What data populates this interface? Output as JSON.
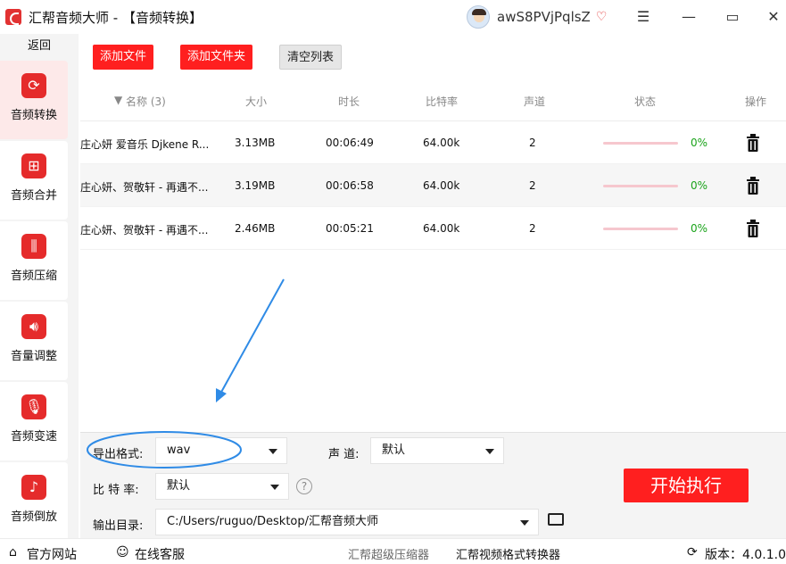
{
  "app": {
    "title": "汇帮音频大师 - 【音频转换】",
    "user": "awS8PVjPqlsZ"
  },
  "sidebar": {
    "back": "返回",
    "items": [
      {
        "label": "音频转换",
        "icon": "audio-convert-icon"
      },
      {
        "label": "音频合并",
        "icon": "audio-merge-icon"
      },
      {
        "label": "音频压缩",
        "icon": "audio-compress-icon"
      },
      {
        "label": "音量调整",
        "icon": "volume-icon"
      },
      {
        "label": "音频变速",
        "icon": "speed-icon"
      },
      {
        "label": "音频倒放",
        "icon": "reverse-icon"
      }
    ]
  },
  "toolbar": {
    "add_file": "添加文件",
    "add_folder": "添加文件夹",
    "clear": "清空列表"
  },
  "table": {
    "headers": {
      "name": "名称 (3)",
      "size": "大小",
      "duration": "时长",
      "bitrate": "比特率",
      "channels": "声道",
      "status": "状态",
      "actions": "操作"
    },
    "rows": [
      {
        "name": "庄心妍 爱音乐 Djkene R...",
        "size": "3.13MB",
        "duration": "00:06:49",
        "bitrate": "64.00k",
        "channels": "2",
        "progress": 0,
        "pct": "0%"
      },
      {
        "name": "庄心妍、贺敬轩 - 再遇不...",
        "size": "3.19MB",
        "duration": "00:06:58",
        "bitrate": "64.00k",
        "channels": "2",
        "progress": 0,
        "pct": "0%"
      },
      {
        "name": "庄心妍、贺敬轩 - 再遇不...",
        "size": "2.46MB",
        "duration": "00:05:21",
        "bitrate": "64.00k",
        "channels": "2",
        "progress": 0,
        "pct": "0%"
      }
    ]
  },
  "settings": {
    "format_label": "导出格式:",
    "format_value": "wav",
    "channel_label": "声 道:",
    "channel_value": "默认",
    "bitrate_label": "比 特 率:",
    "bitrate_value": "默认",
    "output_label": "输出目录:",
    "output_value": "C:/Users/ruguo/Desktop/汇帮音频大师",
    "start": "开始执行"
  },
  "statusbar": {
    "website": "官方网站",
    "support": "在线客服",
    "compressor": "汇帮超级压缩器",
    "video_converter": "汇帮视频格式转换器",
    "version": "版本：4.0.1.0"
  },
  "colors": {
    "accent": "#ff1f1f",
    "progress": "#f6c7ce",
    "pct": "#1aa31a",
    "annotation": "#2f8be6"
  }
}
